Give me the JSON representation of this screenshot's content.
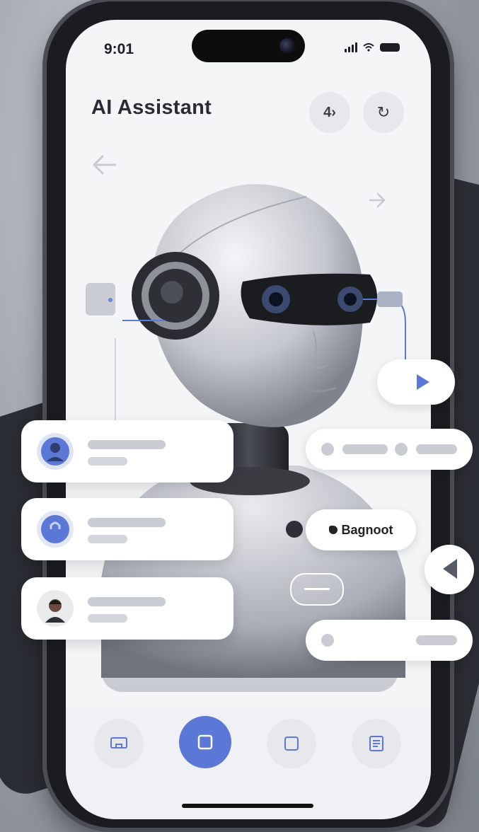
{
  "status_bar": {
    "time": "9:01"
  },
  "header": {
    "title": "AI Assistant",
    "voice_button_icon": "speaker-wave-icon",
    "voice_button_glyph": "4›",
    "refresh_button_icon": "refresh-icon",
    "refresh_button_glyph": "↻"
  },
  "floating": {
    "name_chip_label": "Bagnoot",
    "name_chip_icon": "chat-bubble-icon"
  },
  "contacts": [
    {
      "avatar": "person-avatar-blue"
    },
    {
      "avatar": "lock-avatar-blue"
    },
    {
      "avatar": "person-avatar-photo"
    }
  ],
  "bottom_nav": [
    {
      "icon": "cast-icon",
      "active": false
    },
    {
      "icon": "square-icon",
      "active": true
    },
    {
      "icon": "square-outline-icon",
      "active": false
    },
    {
      "icon": "document-icon",
      "active": false
    }
  ],
  "colors": {
    "accent": "#5b78d6",
    "screen_bg": "#f4f5f7",
    "text": "#2a2c33"
  }
}
